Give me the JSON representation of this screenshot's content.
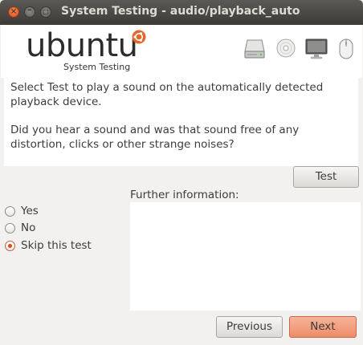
{
  "window": {
    "title": "System Testing - audio/playback_auto",
    "close_glyph": "×",
    "minimize_glyph": "–",
    "maximize_glyph": "□"
  },
  "header": {
    "logo_text": "ubuntu",
    "logo_subtitle": "System Testing",
    "icons": [
      "hard-drive-icon",
      "cd-disc-icon",
      "monitor-icon",
      "mouse-icon"
    ]
  },
  "description": {
    "paragraph1": "Select Test to play a sound on the automatically detected playback device.",
    "paragraph2": "Did you hear a sound and was that sound free of any distortion, clicks or other strange noises?"
  },
  "test_button": {
    "label": "Test"
  },
  "options": [
    {
      "label": "Yes",
      "checked": false
    },
    {
      "label": "No",
      "checked": false
    },
    {
      "label": "Skip this test",
      "checked": true
    }
  ],
  "further_info": {
    "label": "Further information:",
    "value": ""
  },
  "footer": {
    "previous_label": "Previous",
    "next_label": "Next"
  },
  "colors": {
    "accent": "#df4a16",
    "titlebar": "#3c3b37",
    "next_button": "#ee8c68"
  }
}
